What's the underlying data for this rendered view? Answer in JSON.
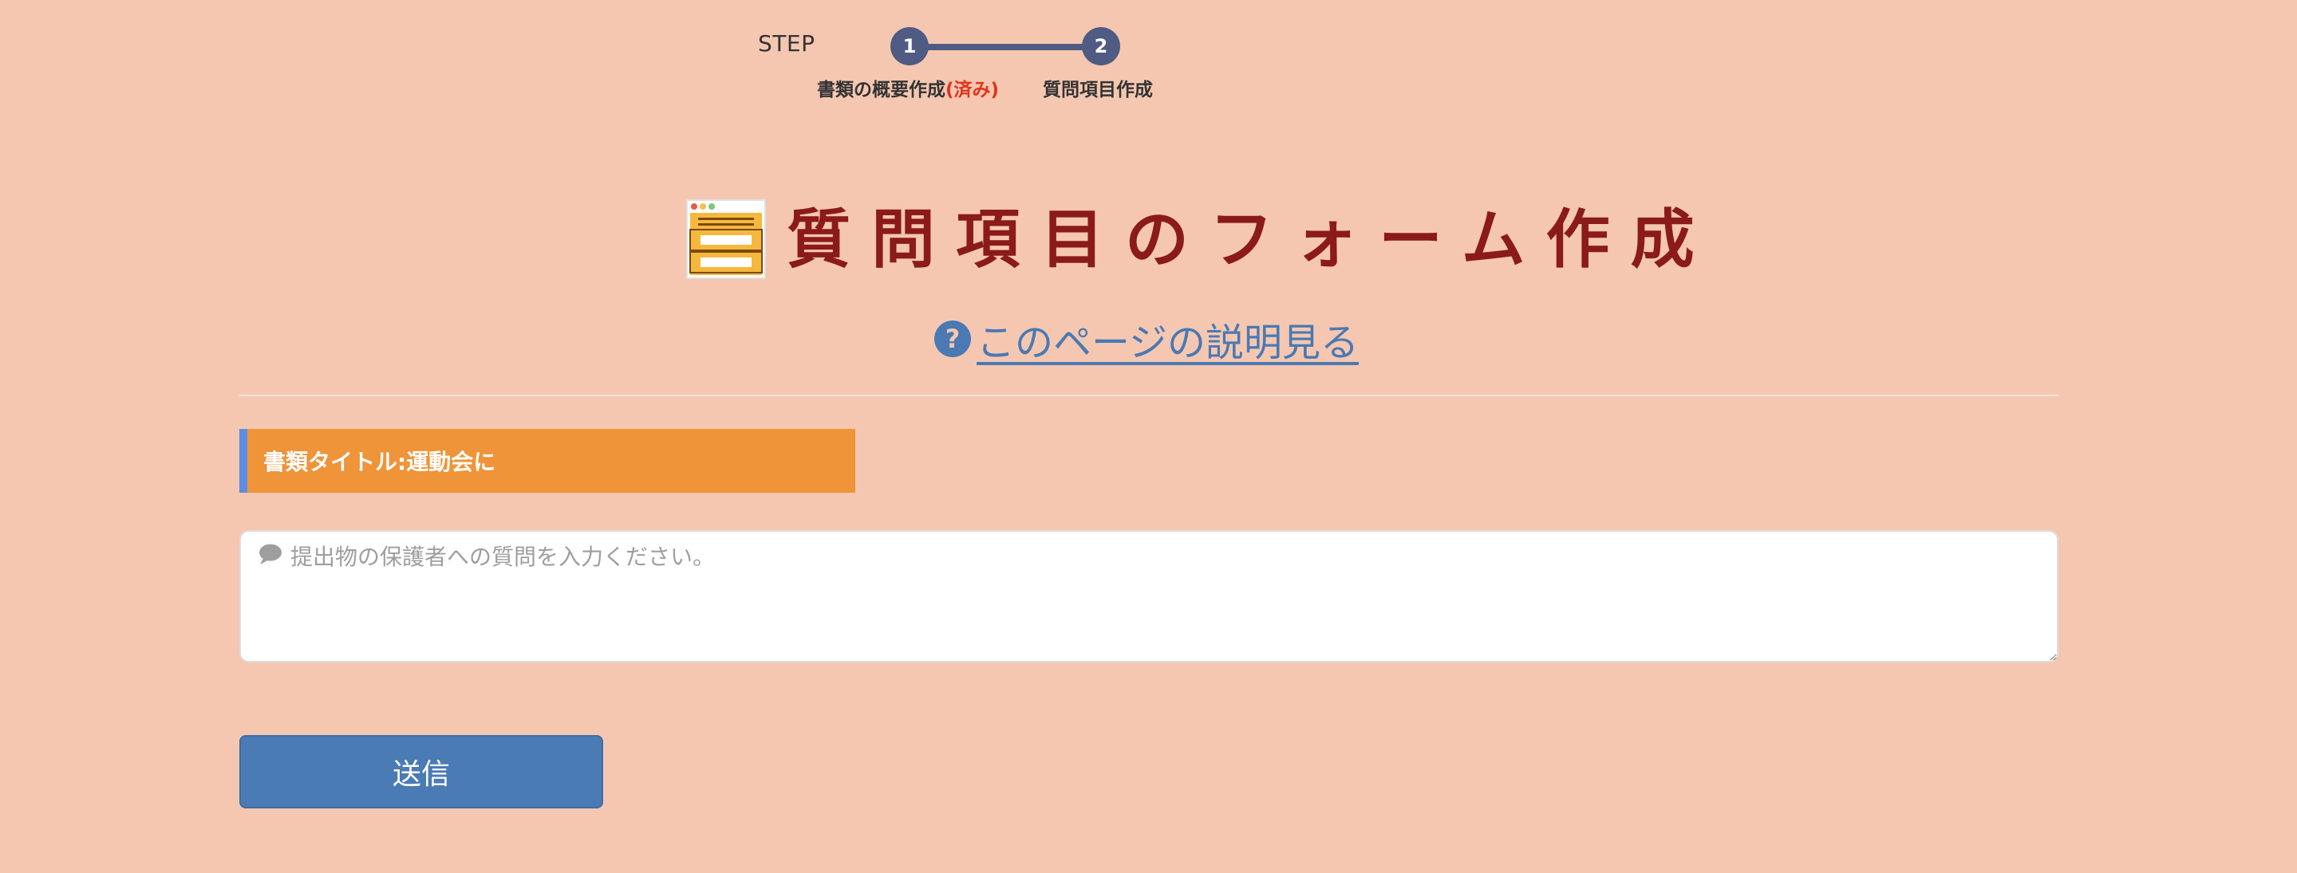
{
  "colors": {
    "background": "#f5c7b1",
    "step_circle": "#4f5b82",
    "step_done": "#e2321c",
    "title": "#8b1a1a",
    "link": "#4a79b3",
    "title_bar": "#ef9438",
    "title_bar_accent": "#5b8ee6",
    "button": "#4a7bb5"
  },
  "steps": {
    "label": "STEP",
    "items": [
      {
        "number": "1",
        "caption": "書類の概要作成",
        "status": "(済み)"
      },
      {
        "number": "2",
        "caption": "質問項目作成"
      }
    ]
  },
  "heading": {
    "icon": "form-window-icon",
    "title": "質問項目のフォーム作成"
  },
  "help": {
    "icon": "question-circle-icon",
    "text": "このページの説明見る"
  },
  "document": {
    "title_text": "書類タイトル:運動会に"
  },
  "question": {
    "icon": "comment-icon",
    "placeholder": "提出物の保護者への質問を入力ください。",
    "value": ""
  },
  "submit": {
    "label": "送信"
  }
}
